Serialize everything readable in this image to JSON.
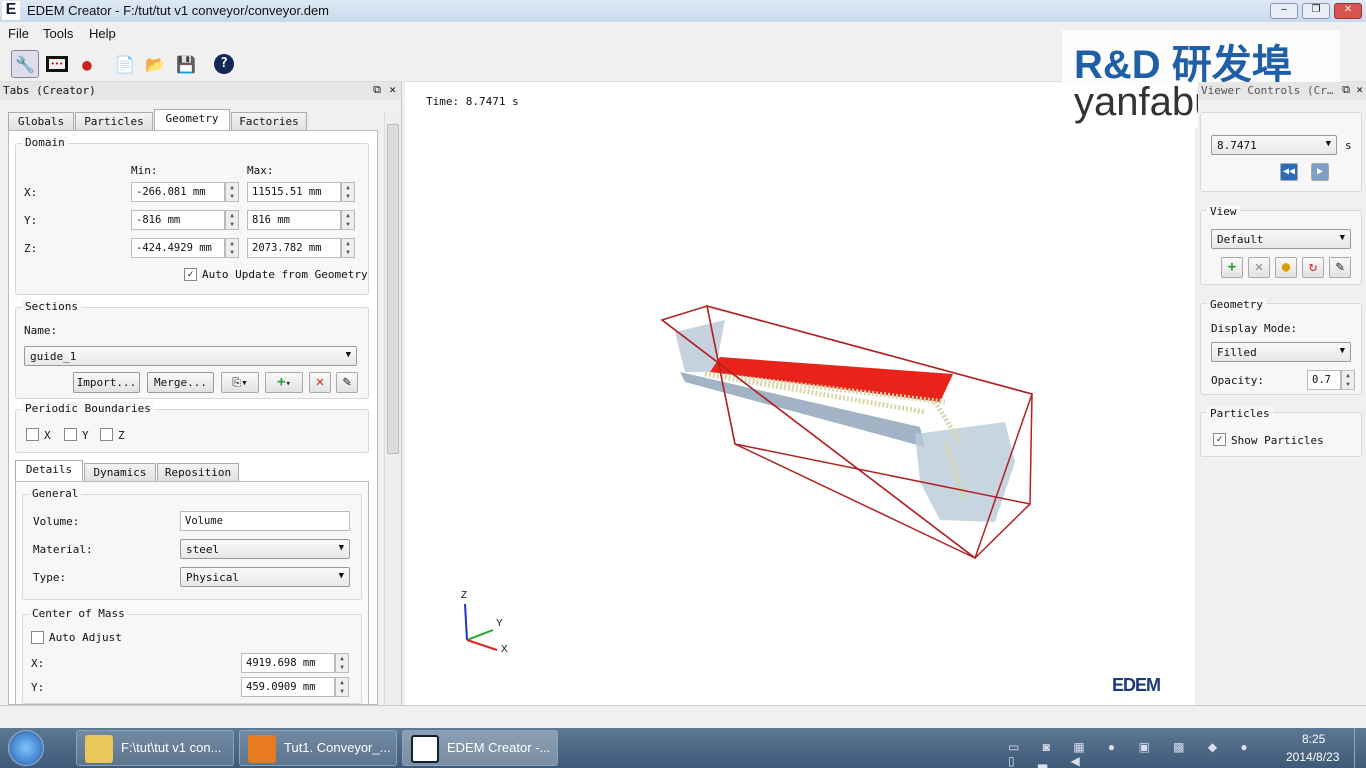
{
  "window": {
    "title": "EDEM Creator - F:/tut/tut v1 conveyor/conveyor.dem",
    "app_icon": "E"
  },
  "menu": [
    "File",
    "Tools",
    "Help"
  ],
  "toolbar_icons": [
    "creator-icon",
    "analyst-icon",
    "simulator-icon",
    "new-icon",
    "open-icon",
    "save-icon",
    "help-icon"
  ],
  "left_dock": {
    "title": "Tabs (Creator)",
    "tabs": [
      "Globals",
      "Particles",
      "Geometry",
      "Factories"
    ],
    "active_tab": "Geometry",
    "domain": {
      "label": "Domain",
      "min_label": "Min:",
      "max_label": "Max:",
      "rows": [
        {
          "axis": "X:",
          "min": "-266.081 mm",
          "max": "11515.51 mm"
        },
        {
          "axis": "Y:",
          "min": "-816 mm",
          "max": "816 mm"
        },
        {
          "axis": "Z:",
          "min": "-424.4929 mm",
          "max": "2073.782 mm"
        }
      ],
      "auto_update": "Auto Update from Geometry",
      "auto_update_checked": true
    },
    "sections": {
      "label": "Sections",
      "name_label": "Name:",
      "name_value": "guide_1",
      "import": "Import...",
      "merge": "Merge..."
    },
    "periodic": {
      "label": "Periodic Boundaries",
      "options": [
        "X",
        "Y",
        "Z"
      ]
    },
    "subtabs": [
      "Details",
      "Dynamics",
      "Reposition"
    ],
    "active_subtab": "Details",
    "general": {
      "label": "General",
      "volume_label": "Volume:",
      "volume_value": "Volume",
      "material_label": "Material:",
      "material_value": "steel",
      "type_label": "Type:",
      "type_value": "Physical"
    },
    "com": {
      "label": "Center of Mass",
      "auto_adjust": "Auto Adjust",
      "x_label": "X:",
      "x_value": "4919.698 mm",
      "y_label": "Y:",
      "y_value": "459.0909 mm"
    }
  },
  "viewer": {
    "time_label": "Time: 8.7471 s",
    "logo": "EDEM",
    "axes": {
      "z": "Z",
      "y": "Y",
      "x": "X"
    }
  },
  "right_dock": {
    "title": "Viewer Controls (Cr…",
    "time_value": "8.7471",
    "time_unit": "s",
    "view": {
      "label": "View",
      "value": "Default"
    },
    "geometry": {
      "label": "Geometry",
      "display_mode_label": "Display Mode:",
      "display_mode": "Filled",
      "opacity_label": "Opacity:",
      "opacity": "0.7"
    },
    "particles": {
      "label": "Particles",
      "show": "Show Particles",
      "show_checked": true
    }
  },
  "watermark": {
    "brand": "R&D 研发埠",
    "url": "yanfabu.com"
  },
  "taskbar": {
    "tasks": [
      "F:\\tut\\tut v1 con...",
      "Tut1. Conveyor_...",
      "EDEM Creator -..."
    ],
    "clock_time": "8:25",
    "clock_date": "2014/8/23"
  },
  "colors": {
    "geometry_red": "#e8231a",
    "box_edge": "#b22222",
    "accent": "#1f5fa8"
  }
}
